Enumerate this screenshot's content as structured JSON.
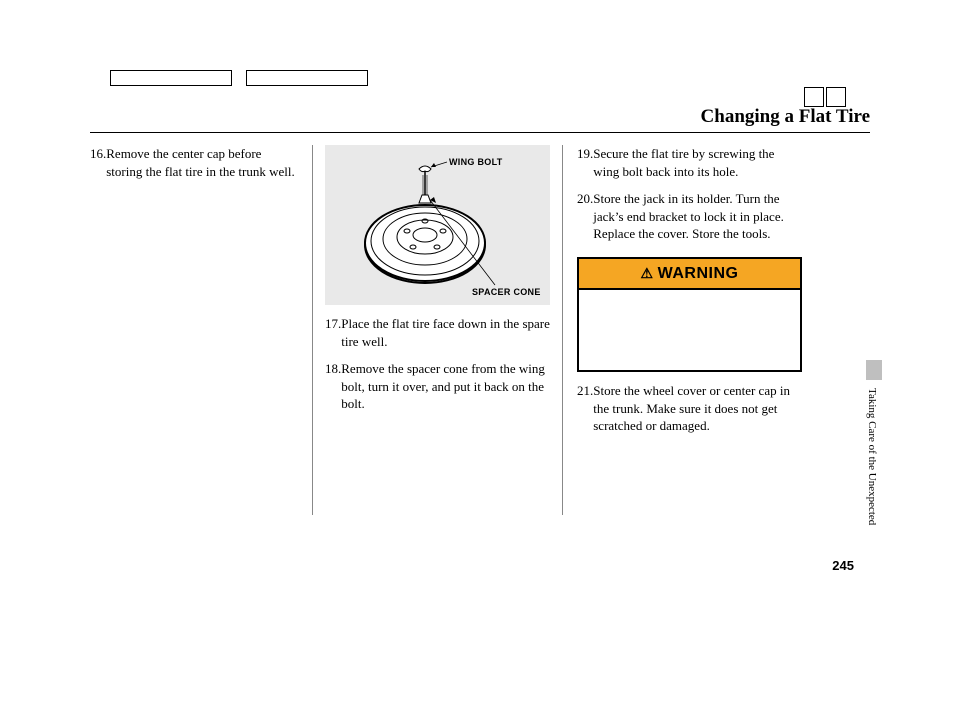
{
  "title": "Changing a Flat Tire",
  "section_label": "Taking Care of the Unexpected",
  "page_number": "245",
  "figure": {
    "label_top": "WING BOLT",
    "label_bottom": "SPACER CONE"
  },
  "warning": {
    "heading": "WARNING"
  },
  "steps": {
    "s16": {
      "num": "16.",
      "text": "Remove the center cap before storing the flat tire in the trunk well."
    },
    "s17": {
      "num": "17.",
      "text": "Place the flat tire face down in the spare tire well."
    },
    "s18": {
      "num": "18.",
      "text": "Remove the spacer cone from the wing bolt, turn it over, and put it back on the bolt."
    },
    "s19": {
      "num": "19.",
      "text": "Secure the flat tire by screwing the wing bolt back into its hole."
    },
    "s20": {
      "num": "20.",
      "text": "Store the jack in its holder. Turn the jack’s end bracket to lock it in place. Replace the cover. Store the tools."
    },
    "s21": {
      "num": "21.",
      "text": "Store the wheel cover or center cap in the trunk. Make sure it does not get scratched or damaged."
    }
  }
}
